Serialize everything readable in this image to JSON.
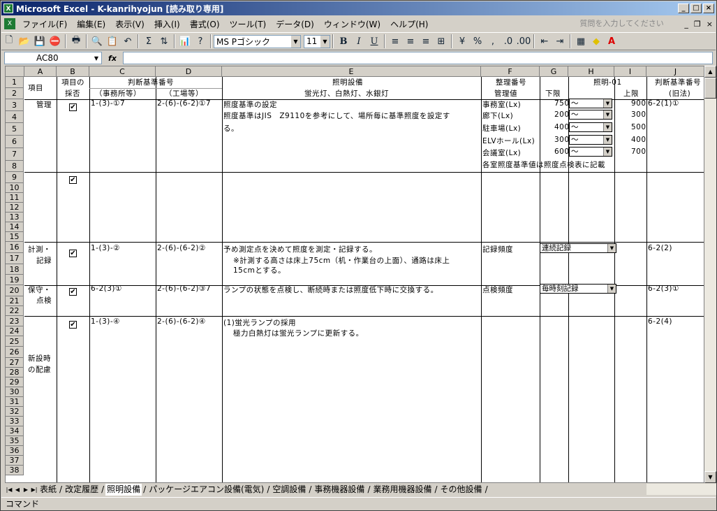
{
  "window": {
    "title": "Microsoft Excel - K-kanrihyojun  [読み取り専用]",
    "app_icon": "excel-icon"
  },
  "menu": [
    "ファイル(F)",
    "編集(E)",
    "表示(V)",
    "挿入(I)",
    "書式(O)",
    "ツール(T)",
    "データ(D)",
    "ウィンドウ(W)",
    "ヘルプ(H)"
  ],
  "help_placeholder": "質問を入力してください",
  "toolbar": {
    "font": "MS Pゴシック",
    "size": "11",
    "bold": "B",
    "italic": "I",
    "underline": "U",
    "percent": "%",
    "comma": ",",
    "sum": "Σ"
  },
  "namebox": "AC80",
  "fx": "fx",
  "columns": [
    "A",
    "B",
    "C",
    "D",
    "E",
    "F",
    "G",
    "H",
    "I",
    "J"
  ],
  "rows": [
    "1",
    "2",
    "3",
    "4",
    "5",
    "6",
    "7",
    "8",
    "9",
    "10",
    "11",
    "12",
    "13",
    "14",
    "15",
    "16",
    "17",
    "18",
    "19",
    "20",
    "21",
    "22",
    "23",
    "24",
    "25",
    "26",
    "27",
    "28",
    "29",
    "30",
    "31",
    "32",
    "33",
    "34",
    "35",
    "36",
    "37",
    "38"
  ],
  "header": {
    "a1": "項目",
    "b1": "項目の",
    "b2": "採否",
    "c1": "判断基準番号",
    "c2": "（事務所等）",
    "d2": "（工場等）",
    "e1": "照明設備",
    "e2": "蛍光灯、白熱灯、水銀灯",
    "f1": "整理番号",
    "h1": "照明-01",
    "f2": "管理値",
    "g2": "下限",
    "i2": "上限",
    "j1": "判断基準番号",
    "j2": "(旧法)"
  },
  "r3": {
    "a": "管理",
    "c": "1-(3)-①7",
    "d": "2-(6)-(6-2)①7",
    "e1": "照度基準の設定",
    "e2": "照度基準はJIS　Z9110を参考にして、場所毎に基準照度を設定す",
    "e3": "る。",
    "j": "6-2(1)①"
  },
  "lux": [
    {
      "name": "事務室(Lx)",
      "low": "750",
      "high": "900"
    },
    {
      "name": "廊下(Lx)",
      "low": "200",
      "high": "300"
    },
    {
      "name": "駐車場(Lx)",
      "low": "400",
      "high": "500"
    },
    {
      "name": "ELVホール(Lx)",
      "low": "300",
      "high": "400"
    },
    {
      "name": "会議室(Lx)",
      "low": "600",
      "high": "700"
    }
  ],
  "tilde": "～",
  "r8f": "各室照度基準値は照度点検表に記載",
  "r16": {
    "a1": "計測・",
    "a2": "記録",
    "c": "1-(3)-②",
    "d": "2-(6)-(6-2)②",
    "e1": "予め測定点を決めて照度を測定・記録する。",
    "e2": "※計測する高さは床上75cm（机・作業台の上面）、通路は床上",
    "e3": "15cmとする。",
    "f": "記録頻度",
    "g": "連続記録",
    "j": "6-2(2)"
  },
  "r20": {
    "a1": "保守・",
    "a2": "点検",
    "c": "6-2(3)①",
    "d": "2-(6)-(6-2)③7",
    "e": "ランプの状態を点検し、断続時または照度低下時に交換する。",
    "f": "点検頻度",
    "g": "毎時刻記録",
    "j": "6-2(3)①"
  },
  "r23": {
    "a1": "新設時",
    "a2": "の配慮",
    "c": "1-(3)-④",
    "d": "2-(6)-(6-2)④",
    "e1": "(1)蛍光ランプの採用",
    "e2": "極力白熱灯は蛍光ランプに更新する。",
    "j": "6-2(4)"
  },
  "check": "✔",
  "tabs": [
    "表紙",
    "改定履歴",
    "照明設備",
    "パッケージエアコン設備(電気)",
    "空調設備",
    "事務機器設備",
    "業務用機器設備",
    "その他設備"
  ],
  "status": "コマンド"
}
